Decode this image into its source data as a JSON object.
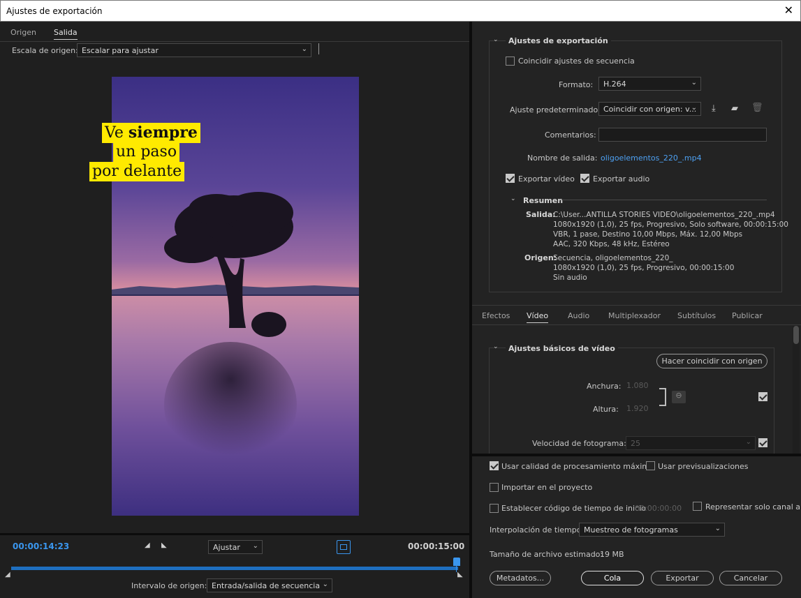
{
  "window": {
    "title": "Ajustes de exportación"
  },
  "left": {
    "tabs": [
      "Origen",
      "Salida"
    ],
    "source_scale_label": "Escala de origen:",
    "source_scale_value": "Escalar para ajustar",
    "caption_line1_a": "Ve ",
    "caption_line1_b": "siempre",
    "caption_line2": "un paso",
    "caption_line3": "por delante",
    "timecode_current": "00:00:14:23",
    "timecode_end": "00:00:15:00",
    "fit_value": "Ajustar",
    "source_range_label": "Intervalo de origen:",
    "source_range_value": "Entrada/salida de secuencia"
  },
  "export_settings": {
    "section_title": "Ajustes de exportación",
    "match_sequence_label": "Coincidir ajustes de secuencia",
    "format_label": "Formato:",
    "format_value": "H.264",
    "preset_label": "Ajuste predeterminado:",
    "preset_value": "Coincidir con origen: v...",
    "comments_label": "Comentarios:",
    "output_name_label": "Nombre de salida:",
    "output_name_value": "oligoelementos_220_.mp4",
    "export_video_label": "Exportar vídeo",
    "export_audio_label": "Exportar audio",
    "summary_title": "Resumen",
    "output_key": "Salida:",
    "output_lines": [
      "C:\\User...ANTILLA STORIES VIDEO\\oligoelementos_220_.mp4",
      "1080x1920 (1,0), 25 fps, Progresivo, Solo software, 00:00:15:00",
      "VBR, 1 pase, Destino 10,00 Mbps, Máx. 12,00 Mbps",
      "AAC, 320 Kbps, 48 kHz, Estéreo"
    ],
    "source_key": "Origen:",
    "source_lines": [
      "Secuencia, oligoelementos_220_",
      "1080x1920 (1,0), 25 fps, Progresivo, 00:00:15:00",
      "Sin audio"
    ]
  },
  "tabs2": [
    "Efectos",
    "Vídeo",
    "Audio",
    "Multiplexador",
    "Subtítulos",
    "Publicar"
  ],
  "video_basic": {
    "section_title": "Ajustes básicos de vídeo",
    "match_source_button": "Hacer coincidir con origen",
    "width_label": "Anchura:",
    "width_value": "1.080",
    "height_label": "Altura:",
    "height_value": "1.920",
    "frame_rate_label": "Velocidad de fotograma:",
    "frame_rate_value": "25"
  },
  "bottom": {
    "max_render_label": "Usar calidad de procesamiento máxima",
    "use_previews_label": "Usar previsualizaciones",
    "import_project_label": "Importar en el proyecto",
    "start_timecode_label": "Establecer código de tiempo de inicio",
    "start_timecode_value": "00:00:00:00",
    "alpha_only_label": "Representar solo canal alfa",
    "time_interp_label": "Interpolación de tiempo:",
    "time_interp_value": "Muestreo de fotogramas",
    "file_size_label": "Tamaño de archivo estimado:",
    "file_size_value": "19 MB",
    "metadata_button": "Metadatos...",
    "queue_button": "Cola",
    "export_button": "Exportar",
    "cancel_button": "Cancelar"
  },
  "colors": {
    "accent": "#1e88e5",
    "link": "#4ea1f3",
    "caption_bg": "#ffea00"
  }
}
